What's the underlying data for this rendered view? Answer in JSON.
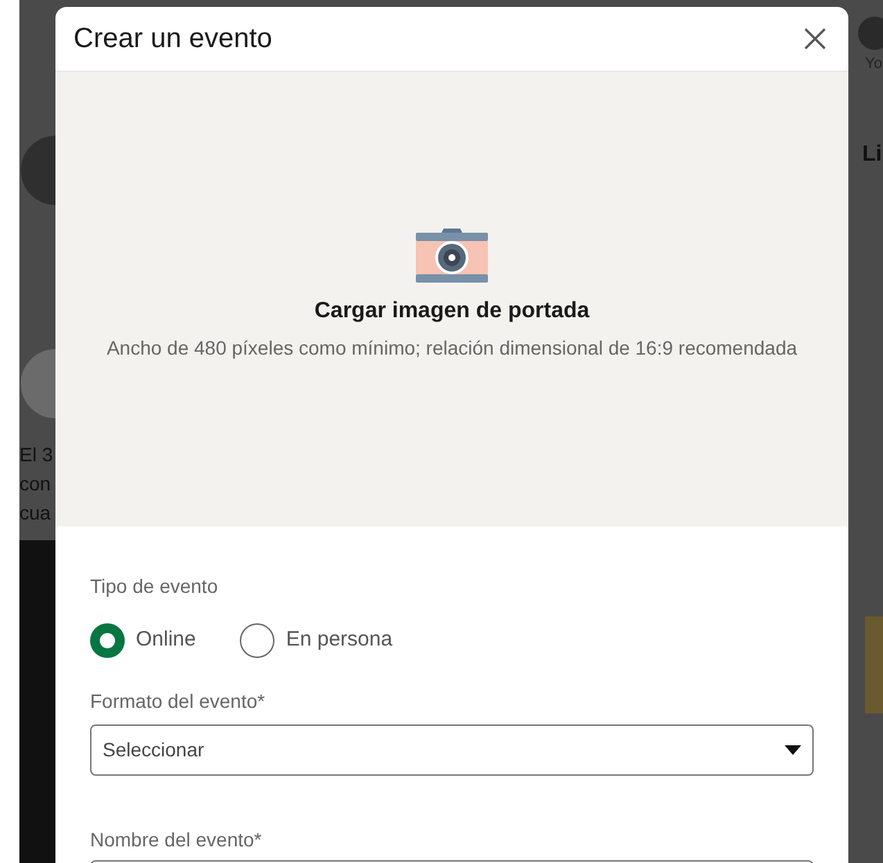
{
  "background": {
    "texts": [
      {
        "kind": "name",
        "text": "Yo"
      },
      {
        "kind": "heading",
        "text": "Li"
      },
      {
        "kind": "post",
        "text": "El 3"
      },
      {
        "kind": "post",
        "text": "con"
      },
      {
        "kind": "post",
        "text": "cua"
      }
    ]
  },
  "dialog": {
    "title": "Crear un evento",
    "cover": {
      "title": "Cargar imagen de portada",
      "hint": "Ancho de 480 píxeles como mínimo; relación dimensional de 16:9 recomendada"
    },
    "event_type": {
      "label": "Tipo de evento",
      "options": [
        {
          "label": "Online",
          "selected": true
        },
        {
          "label": "En persona",
          "selected": false
        }
      ]
    },
    "format": {
      "label": "Formato del evento*",
      "value": "Seleccionar"
    },
    "name": {
      "label": "Nombre del evento*"
    }
  }
}
